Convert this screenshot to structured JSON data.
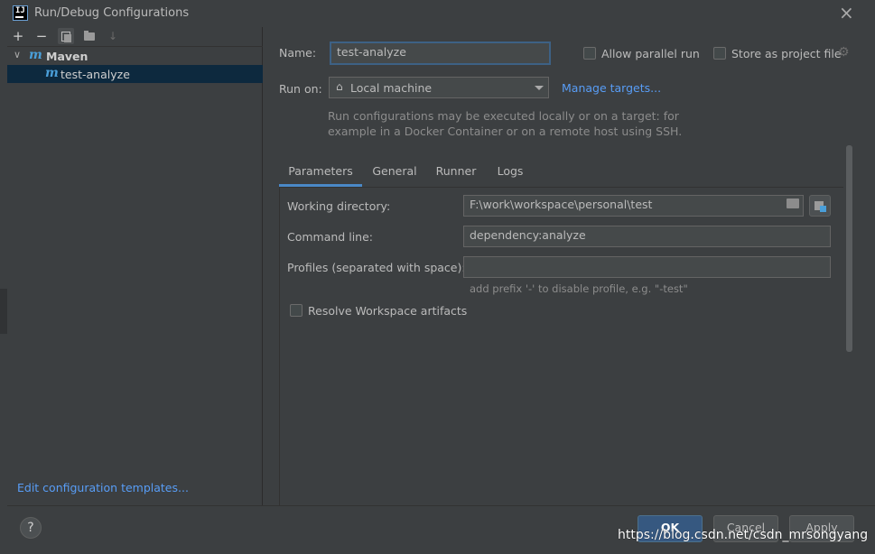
{
  "window": {
    "title": "Run/Debug Configurations",
    "app_icon_text": "IJ"
  },
  "toolbar": {
    "add": "+",
    "remove": "−",
    "sort": "↓"
  },
  "tree": {
    "group_label": "Maven",
    "group_icon": "m",
    "item_icon": "m",
    "item_label": "test-analyze"
  },
  "left": {
    "edit_templates_link": "Edit configuration templates..."
  },
  "form": {
    "name_label": "Name:",
    "name_value": "test-analyze",
    "allow_parallel_label": "Allow parallel run",
    "store_project_label": "Store as project file",
    "run_on_label": "Run on:",
    "run_on_value": "Local machine",
    "manage_targets": "Manage targets...",
    "run_on_hint_1": "Run configurations may be executed locally or on a target: for",
    "run_on_hint_2": "example in a Docker Container or on a remote host using SSH."
  },
  "tabs": [
    "Parameters",
    "General",
    "Runner",
    "Logs"
  ],
  "parameters": {
    "working_dir_label": "Working directory:",
    "working_dir_value": "F:\\work\\workspace\\personal\\test",
    "command_line_label": "Command line:",
    "command_line_value": "dependency:analyze",
    "profiles_label": "Profiles (separated with space):",
    "profiles_value": "",
    "profiles_hint": "add prefix '-' to disable profile, e.g. \"-test\"",
    "resolve_workspace_label": "Resolve Workspace artifacts"
  },
  "buttons": {
    "help": "?",
    "ok": "OK",
    "cancel": "Cancel",
    "apply": "Apply"
  },
  "watermark": "https://blog.csdn.net/csdn_mrsongyang",
  "colors": {
    "background": "#3c3f41",
    "accent": "#4a88c7",
    "link": "#589df6",
    "selection": "#0d293e"
  }
}
